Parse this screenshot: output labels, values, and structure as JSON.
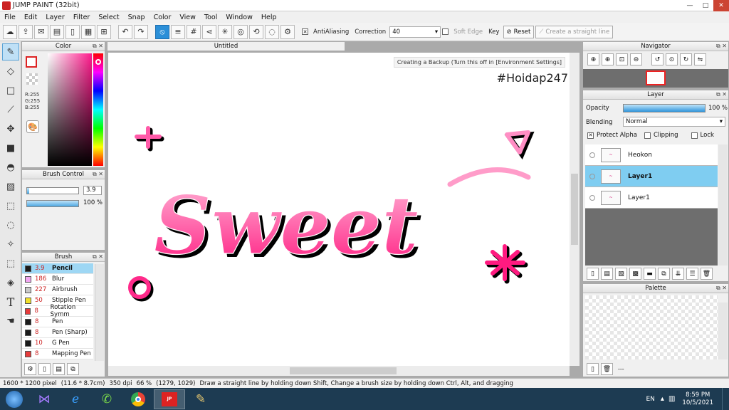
{
  "app": {
    "title": "JUMP PAINT (32bit)"
  },
  "browser_tabs": [
    "",
    "",
    "",
    "",
    ""
  ],
  "window_buttons": [
    "—",
    "□",
    "✕"
  ],
  "menu": [
    "File",
    "Edit",
    "Layer",
    "Filter",
    "Select",
    "Snap",
    "Color",
    "View",
    "Tool",
    "Window",
    "Help"
  ],
  "toolbar": {
    "antialiasing_label": "AntiAliasing",
    "correction_label": "Correction",
    "correction_value": "40",
    "soft_edge_label": "Soft Edge",
    "key_label": "Key",
    "reset_label": "Reset",
    "straight_line_label": "Create a straight line"
  },
  "panels": {
    "color": "Color",
    "brush_control": "Brush Control",
    "brush": "Brush",
    "navigator": "Navigator",
    "layer": "Layer",
    "palette": "Palette"
  },
  "color": {
    "r": "R:255",
    "g": "G:255",
    "b": "B:255",
    "main": "#ffffff",
    "sub": "#ffffff"
  },
  "brush_control": {
    "size": "3.9",
    "opacity": "100 %",
    "size_fraction": 0.04,
    "opacity_fraction": 1.0
  },
  "brushes": [
    {
      "size": "3.9",
      "name": "Pencil",
      "color": "#1a1a1a",
      "selected": true
    },
    {
      "size": "186",
      "name": "Blur",
      "color": "#f2a7f2",
      "selected": false
    },
    {
      "size": "227",
      "name": "Airbrush",
      "color": "#c9c9c9",
      "selected": false
    },
    {
      "size": "50",
      "name": "Stipple Pen",
      "color": "#f2e02a",
      "selected": false
    },
    {
      "size": "8",
      "name": "Rotation Symm",
      "color": "#e63b3b",
      "selected": false
    },
    {
      "size": "8",
      "name": "Pen",
      "color": "#1a1a1a",
      "selected": false
    },
    {
      "size": "8",
      "name": "Pen (Sharp)",
      "color": "#1a1a1a",
      "selected": false
    },
    {
      "size": "10",
      "name": "G Pen",
      "color": "#1a1a1a",
      "selected": false
    },
    {
      "size": "8",
      "name": "Mapping Pen",
      "color": "#e63b3b",
      "selected": false
    }
  ],
  "document": {
    "tab_title": "Untitled",
    "backup_notice": "Creating a Backup (Turn this off in [Environment Settings]",
    "watermark": "#Hoidap247",
    "artwork_text": "Sweet",
    "artwork_color": "#ff2a8a"
  },
  "layer": {
    "opacity_label": "Opacity",
    "opacity_value": "100 %",
    "opacity_fraction": 1.0,
    "blending_label": "Blending",
    "blending_value": "Normal",
    "protect_alpha": "Protect Alpha",
    "clipping": "Clipping",
    "lock": "Lock",
    "layers": [
      {
        "name": "Heokon",
        "selected": false
      },
      {
        "name": "Layer1",
        "selected": true
      },
      {
        "name": "Layer1",
        "selected": false
      }
    ],
    "footer_text": ""
  },
  "palette": {
    "footer_text": "---"
  },
  "status": {
    "size": "1600 * 1200 pixel",
    "cm": "(11.6 * 8.7cm)",
    "dpi": "350 dpi",
    "zoom": "66 %",
    "coords": "(1279, 1029)",
    "hint": "Draw a straight line by holding down Shift, Change a brush size by holding down Ctrl, Alt, and dragging"
  },
  "taskbar": {
    "lang": "EN",
    "time": "8:59 PM",
    "date": "10/5/2021"
  }
}
